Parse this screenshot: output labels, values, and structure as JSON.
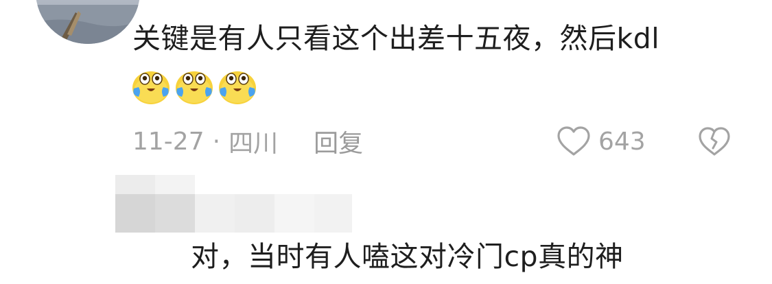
{
  "comment": {
    "text": "关键是有人只看这个出差十五夜，然后kdl",
    "emojis": [
      "crying-laughing-emoji",
      "crying-laughing-emoji",
      "crying-laughing-emoji"
    ],
    "date": "11-27",
    "separator": "·",
    "location": "四川",
    "reply_label": "回复",
    "like_count": "643"
  },
  "reply": {
    "text": "对，当时有人嗑这对冷门cp真的神"
  },
  "colors": {
    "text_primary": "#1e1e1e",
    "text_meta": "#a3a3a3",
    "emoji_yellow": "#f7d23c",
    "emoji_tear": "#4aa3f0",
    "redaction_gray": "#d8d8d8"
  }
}
